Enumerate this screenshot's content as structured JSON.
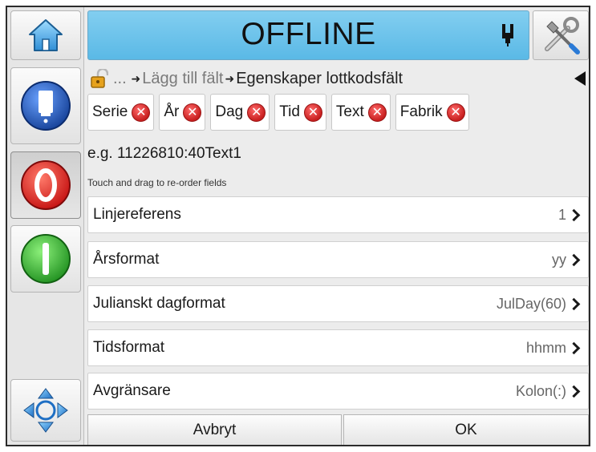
{
  "header": {
    "status": "OFFLINE"
  },
  "icons": {
    "home": "home-icon",
    "tools": "tools-icon",
    "ink": "ink-cartridge-icon",
    "lock": "lock-icon",
    "back": "back-arrow-icon",
    "nav": "four-way-arrows-icon",
    "stop": "stop-icon",
    "start": "start-icon",
    "printhead": "printhead-status-icon"
  },
  "breadcrumb": {
    "ellipsis": "...",
    "step1": "Lägg till fält",
    "step2": "Egenskaper lottkodsfält"
  },
  "fields": [
    {
      "label": "Serie"
    },
    {
      "label": "År"
    },
    {
      "label": "Dag"
    },
    {
      "label": "Tid"
    },
    {
      "label": "Text"
    },
    {
      "label": "Fabrik"
    }
  ],
  "example": "e.g. 11226810:40Text1",
  "hint": "Touch and drag to re-order fields",
  "settings": [
    {
      "label": "Linjereferens",
      "value": "1"
    },
    {
      "label": "Årsformat",
      "value": "yy"
    },
    {
      "label": "Julianskt dagformat",
      "value": "JulDay(60)"
    },
    {
      "label": "Tidsformat",
      "value": "hhmm"
    },
    {
      "label": "Avgränsare",
      "value": "Kolon(:)"
    }
  ],
  "footer": {
    "cancel": "Avbryt",
    "ok": "OK"
  },
  "colors": {
    "status_bar": "#5ab9e6",
    "remove_chip": "#c81f1f",
    "stop_button": "#e02020",
    "start_button": "#2fae2f",
    "printhead_button": "#1e56b8"
  }
}
